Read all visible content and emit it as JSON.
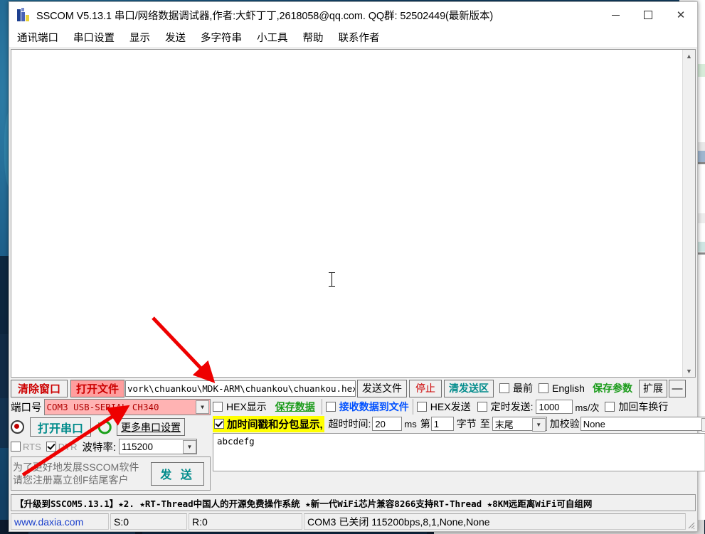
{
  "window": {
    "title": "SSCOM V5.13.1 串口/网络数据调试器,作者:大虾丁丁,2618058@qq.com. QQ群: 52502449(最新版本)",
    "app_icon": "sscom-logo-icon",
    "minimize": "minimize-icon",
    "maximize": "maximize-icon",
    "close": "close-icon"
  },
  "menu": {
    "items": [
      {
        "label": "通讯端口"
      },
      {
        "label": "串口设置"
      },
      {
        "label": "显示"
      },
      {
        "label": "发送"
      },
      {
        "label": "多字符串"
      },
      {
        "label": "小工具"
      },
      {
        "label": "帮助"
      },
      {
        "label": "联系作者"
      }
    ]
  },
  "receive": {
    "text": "",
    "scroll_up": "▲",
    "scroll_down": "▼"
  },
  "toolbar": {
    "clear_window": "清除窗口",
    "open_file": "打开文件",
    "file_path": "vork\\chuankou\\MDK-ARM\\chuankou\\chuankou.hex",
    "send_file": "发送文件",
    "stop": "停止",
    "clear_send": "清发送区",
    "topmost_label": "最前",
    "english_label": "English",
    "save_params": "保存参数",
    "expand": "扩展",
    "minus": "—"
  },
  "serial": {
    "port_label": "端口号",
    "port_value": "COM3 USB-SERIAL CH340",
    "open_port": "打开串口",
    "refresh": "refresh-icon",
    "more_settings": "更多串口设置",
    "rts_label": "RTS",
    "dtr_label": "DTR",
    "baud_label": "波特率:",
    "baud_value": "115200"
  },
  "promo": {
    "line1": "为了更好地发展SSCOM软件",
    "line2": "请您注册嘉立创F结尾客户",
    "send_button": "发 送"
  },
  "recv_options": {
    "hex_display": "HEX显示",
    "save_data": "保存数据",
    "recv_to_file": "接收数据到文件",
    "timestamp": "加时间戳和分包显示,",
    "timeout_label": "超时时间:",
    "timeout_value": "20",
    "timeout_unit": "ms",
    "byte_prefix": "第",
    "byte_value": "1",
    "byte_label": "字节",
    "to_label": "至",
    "to_value": "末尾",
    "checksum_label": "加校验",
    "checksum_value": "None"
  },
  "send_options": {
    "hex_send": "HEX发送",
    "timed_send": "定时发送:",
    "timed_value": "1000",
    "timed_unit": "ms/次",
    "crlf": "加回车换行",
    "help_mark": "?"
  },
  "send_area": {
    "content": "abcdefg"
  },
  "banner": {
    "text": "【升级到SSCOM5.13.1】★2.  ★RT-Thread中国人的开源免费操作系统 ★新一代WiFi芯片兼容8266支持RT-Thread ★8KM远距离WiFi可自组网"
  },
  "status": {
    "site": "www.daxia.com",
    "sent": "S:0",
    "received": "R:0",
    "connection": "COM3 已关闭  115200bps,8,1,None,None"
  },
  "checkbox_states": {
    "topmost": false,
    "english": false,
    "hex_display": false,
    "recv_to_file": false,
    "timestamp": true,
    "hex_send": false,
    "timed_send": false,
    "crlf": false,
    "rts": false,
    "dtr": true
  },
  "colors": {
    "accent_red": "#cc0000",
    "accent_teal": "#008b8b",
    "accent_green": "#1a9b1a",
    "accent_blue": "#0050ff",
    "highlight_yellow": "#ffff00",
    "port_pink": "#ffb3b3",
    "annotation_red": "#ee0000"
  },
  "annotations": {
    "arrow1": "red-arrow-pointing-to-file-path",
    "arrow2": "red-arrow-pointing-to-port-select"
  }
}
